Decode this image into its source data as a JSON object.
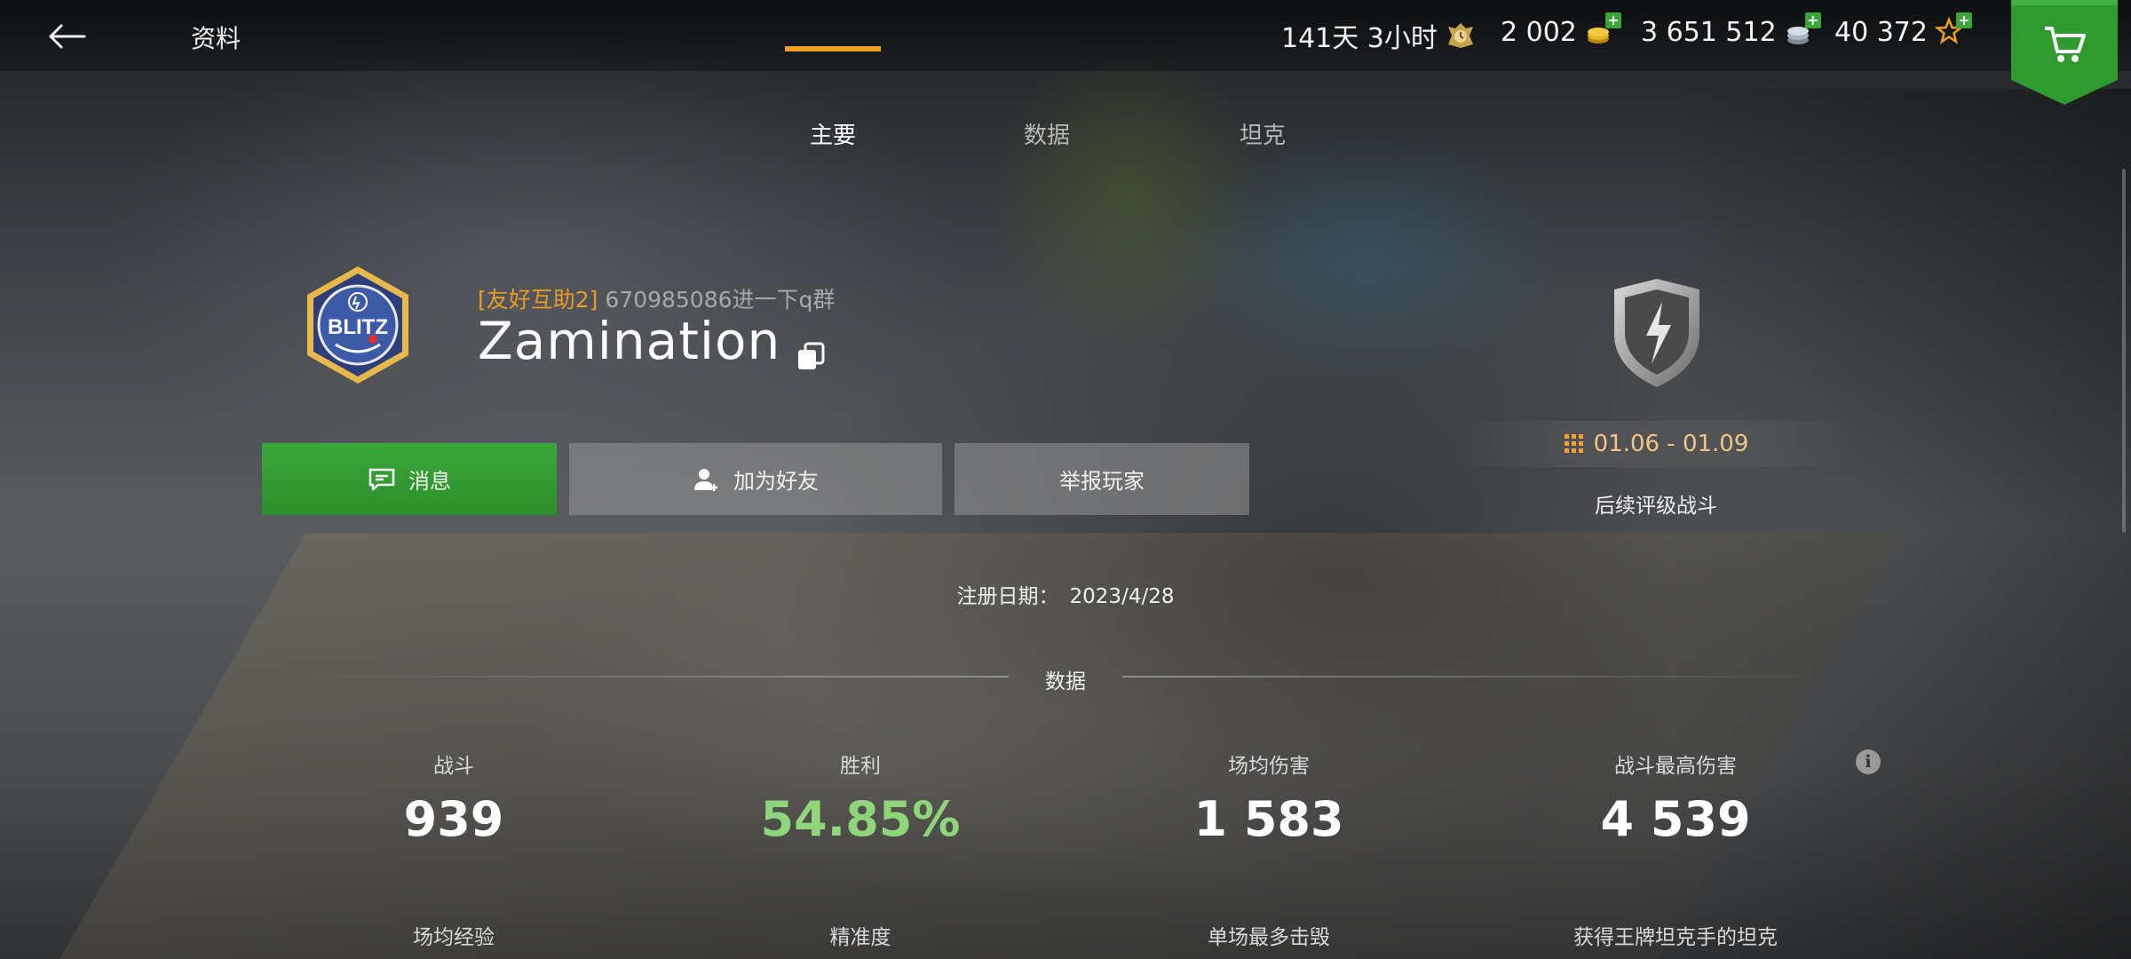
{
  "header": {
    "title": "资料",
    "currencies": [
      {
        "icon": "premium-time-icon",
        "value": "141天 3小时"
      },
      {
        "icon": "gold-icon",
        "value": "2 002"
      },
      {
        "icon": "credits-icon",
        "value": "3 651 512"
      },
      {
        "icon": "free-xp-icon",
        "value": "40 372"
      }
    ]
  },
  "tabs": [
    {
      "label": "主要",
      "active": true
    },
    {
      "label": "数据",
      "active": false
    },
    {
      "label": "坦克",
      "active": false
    }
  ],
  "profile": {
    "clan_tag": "[友好互助2]",
    "clan_desc": "670985086进一下q群",
    "name": "Zamination",
    "badge_text": "BLITZ"
  },
  "actions": {
    "message": "消息",
    "add_friend": "加为好友",
    "report": "举报玩家"
  },
  "rating": {
    "dates": "01.06 - 01.09",
    "label": "后续评级战斗"
  },
  "registration": {
    "label": "注册日期：",
    "date": "2023/4/28"
  },
  "stats_section": {
    "title": "数据",
    "primary": [
      {
        "label": "战斗",
        "value": "939"
      },
      {
        "label": "胜利",
        "value": "54.85%"
      },
      {
        "label": "场均伤害",
        "value": "1 583"
      },
      {
        "label": "战斗最高伤害",
        "value": "4 539"
      }
    ],
    "secondary": [
      {
        "label": "场均经验"
      },
      {
        "label": "精准度"
      },
      {
        "label": "单场最多击毁"
      },
      {
        "label": "获得王牌坦克手的坦克"
      }
    ]
  },
  "colors": {
    "accent": "#f0a020",
    "primary_button": "#33a033",
    "win_rate": "#8fd57a",
    "clan_tag": "#e89a25"
  }
}
